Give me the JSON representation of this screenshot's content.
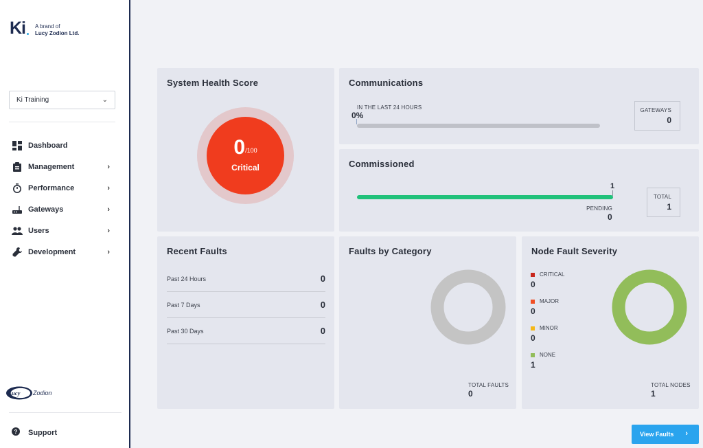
{
  "brand": {
    "logo": "Ki",
    "tagline": "A brand of",
    "company": "Lucy Zodion Ltd."
  },
  "org_selector": {
    "value": "Ki Training"
  },
  "nav": [
    {
      "label": "Dashboard",
      "icon": "dashboard-icon",
      "has_submenu": false
    },
    {
      "label": "Management",
      "icon": "clipboard-icon",
      "has_submenu": true
    },
    {
      "label": "Performance",
      "icon": "stopwatch-icon",
      "has_submenu": true
    },
    {
      "label": "Gateways",
      "icon": "router-icon",
      "has_submenu": true
    },
    {
      "label": "Users",
      "icon": "users-icon",
      "has_submenu": true
    },
    {
      "label": "Development",
      "icon": "wrench-icon",
      "has_submenu": true
    }
  ],
  "footer_logo": {
    "text": "Zodion",
    "badge_text": "Lucy"
  },
  "support": {
    "label": "Support"
  },
  "health": {
    "title": "System Health Score",
    "score": "0",
    "max": "/100",
    "status": "Critical",
    "colors": {
      "ring": "#e3c8cb",
      "core": "#f03c1e"
    }
  },
  "communications": {
    "title": "Communications",
    "period_label": "IN THE LAST 24 HOURS",
    "percent": "0%",
    "progress": 0,
    "gateways_label": "GATEWAYS",
    "gateways_value": "0"
  },
  "commissioned": {
    "title": "Commissioned",
    "count": "1",
    "progress": 1,
    "pending_label": "PENDING",
    "pending_value": "0",
    "total_label": "TOTAL",
    "total_value": "1",
    "bar_color": "#20c17a"
  },
  "recent_faults": {
    "title": "Recent Faults",
    "rows": [
      {
        "label": "Past 24 Hours",
        "value": "0"
      },
      {
        "label": "Past 7 Days",
        "value": "0"
      },
      {
        "label": "Past 30 Days",
        "value": "0"
      }
    ]
  },
  "faults_by_category": {
    "title": "Faults by Category",
    "total_label": "TOTAL FAULTS",
    "total_value": "0",
    "empty_color": "#c4c4c4"
  },
  "node_fault_severity": {
    "title": "Node Fault Severity",
    "items": [
      {
        "name": "CRITICAL",
        "value": "0",
        "color": "#c8261c"
      },
      {
        "name": "MAJOR",
        "value": "0",
        "color": "#f04e23"
      },
      {
        "name": "MINOR",
        "value": "0",
        "color": "#f5b818"
      },
      {
        "name": "NONE",
        "value": "1",
        "color": "#92bd5a"
      }
    ],
    "total_label": "TOTAL NODES",
    "total_value": "1"
  },
  "view_faults": {
    "label": "View Faults"
  }
}
